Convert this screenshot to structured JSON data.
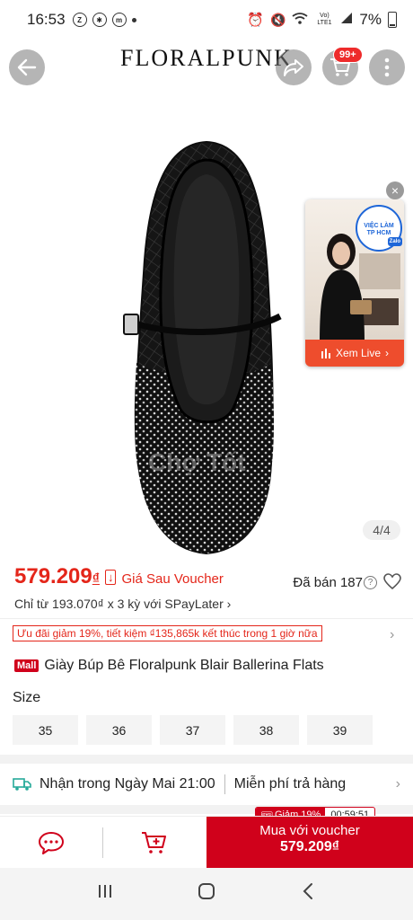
{
  "status_bar": {
    "time": "16:53",
    "notif_icons": [
      "zalo-icon",
      "gear-icon",
      "messenger-icon",
      "dot-icon"
    ],
    "right_icons": [
      "alarm-icon",
      "mute-icon",
      "wifi-icon",
      "lte-icon",
      "signal-icon"
    ],
    "network_label": "Vo) LTE1",
    "battery": "7%"
  },
  "header": {
    "brand": "FLORALPUNK",
    "cart_badge": "99+"
  },
  "gallery": {
    "page_indicator": "4/4",
    "watermark": "Chợ Tốt"
  },
  "live": {
    "button_label": "Xem Live",
    "tag_lines": [
      "VIỆC LÀM",
      "TP HCM"
    ],
    "tag_app": "Zalo"
  },
  "product": {
    "price": "579.209",
    "price_currency": "₫",
    "price_badge": "↓",
    "after_voucher_label": "Giá Sau Voucher",
    "sold_label": "Đã bán 187",
    "installment": "Chỉ từ 193.070₫ x 3 kỳ với SPayLater ›",
    "promo": "Ưu đãi giảm 19%, tiết kiệm ₫135,865k kết thúc trong 1 giờ nữa",
    "mall_badge": "Mall",
    "title": "Giày Búp Bê Floralpunk Blair Ballerina Flats"
  },
  "sizes": {
    "label": "Size",
    "options": [
      "35",
      "36",
      "37",
      "38",
      "39"
    ]
  },
  "shipping": {
    "delivery": "Nhận trong Ngày Mai 21:00",
    "returns": "Miễn phí trả hàng"
  },
  "bottom": {
    "flash_discount": "Giảm 19%",
    "flash_timer": "00:59:51",
    "buy_label": "Mua với voucher",
    "buy_price": "579.209₫"
  },
  "colors": {
    "accent_red": "#e4261a",
    "buy_red": "#d0011b",
    "live_orange": "#ee4d2d"
  }
}
